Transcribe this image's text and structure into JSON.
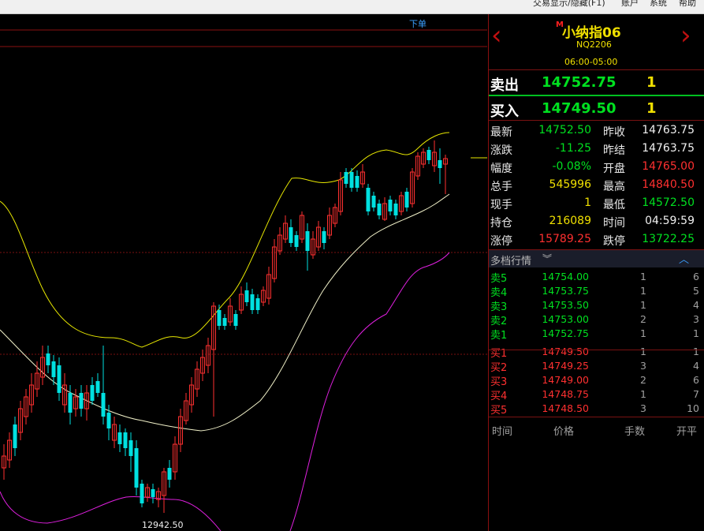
{
  "menu": {
    "items": [
      "交易显示/隐藏(F1)",
      "账户",
      "系统",
      "帮助"
    ]
  },
  "chart": {
    "order_label": "下单",
    "low_price_label": "12942.50",
    "colors": {
      "up": "#ff3030",
      "down": "#00e0e0",
      "upper_band": "#e8e800",
      "mid_band": "#f0f0c8",
      "lower_band": "#e020e0",
      "grid": "#8a1010"
    }
  },
  "header": {
    "marker": "M",
    "name": "小纳指06",
    "code": "NQ2206",
    "session": "06:00-05:00"
  },
  "best_quote": {
    "sell_label": "卖出",
    "sell_price": "14752.75",
    "sell_qty": "1",
    "buy_label": "买入",
    "buy_price": "14749.50",
    "buy_qty": "1"
  },
  "stats": [
    {
      "l1": "最新",
      "v1": "14752.50",
      "c1": "green",
      "l2": "昨收",
      "v2": "14763.75",
      "c2": "white"
    },
    {
      "l1": "涨跌",
      "v1": "-11.25",
      "c1": "green",
      "l2": "昨结",
      "v2": "14763.75",
      "c2": "white"
    },
    {
      "l1": "幅度",
      "v1": "-0.08%",
      "c1": "green",
      "l2": "开盘",
      "v2": "14765.00",
      "c2": "red"
    },
    {
      "l1": "总手",
      "v1": "545996",
      "c1": "yellow",
      "l2": "最高",
      "v2": "14840.50",
      "c2": "red"
    },
    {
      "l1": "现手",
      "v1": "1",
      "c1": "yellow",
      "l2": "最低",
      "v2": "14572.50",
      "c2": "green"
    },
    {
      "l1": "持仓",
      "v1": "216089",
      "c1": "yellow",
      "l2": "时间",
      "v2": "04:59:59",
      "c2": "white"
    },
    {
      "l1": "涨停",
      "v1": "15789.25",
      "c1": "red",
      "l2": "跌停",
      "v2": "13722.25",
      "c2": "green"
    }
  ],
  "depth": {
    "title": "多档行情",
    "asks": [
      {
        "label": "卖5",
        "price": "14754.00",
        "qty": "1",
        "orders": "6"
      },
      {
        "label": "卖4",
        "price": "14753.75",
        "qty": "1",
        "orders": "5"
      },
      {
        "label": "卖3",
        "price": "14753.50",
        "qty": "1",
        "orders": "4"
      },
      {
        "label": "卖2",
        "price": "14753.00",
        "qty": "2",
        "orders": "3"
      },
      {
        "label": "卖1",
        "price": "14752.75",
        "qty": "1",
        "orders": "1"
      }
    ],
    "bids": [
      {
        "label": "买1",
        "price": "14749.50",
        "qty": "1",
        "orders": "1"
      },
      {
        "label": "买2",
        "price": "14749.25",
        "qty": "3",
        "orders": "4"
      },
      {
        "label": "买3",
        "price": "14749.00",
        "qty": "2",
        "orders": "6"
      },
      {
        "label": "买4",
        "price": "14748.75",
        "qty": "1",
        "orders": "7"
      },
      {
        "label": "买5",
        "price": "14748.50",
        "qty": "3",
        "orders": "10"
      }
    ]
  },
  "ticks": {
    "headers": [
      "时间",
      "价格",
      "手数",
      "开平"
    ]
  }
}
